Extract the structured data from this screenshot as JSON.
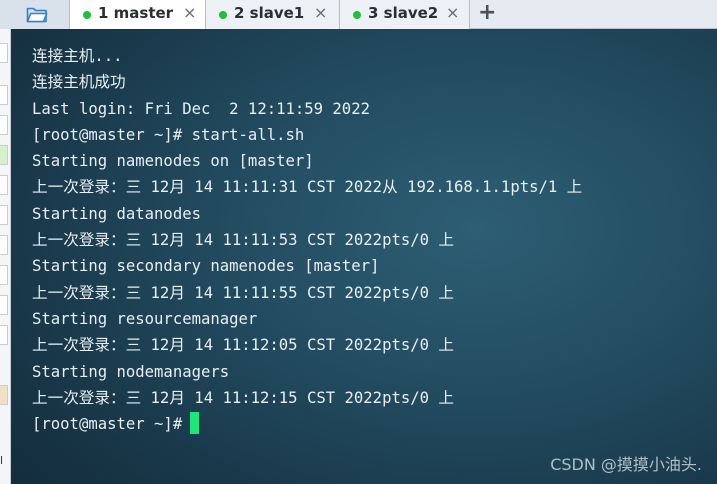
{
  "tabs": [
    {
      "label": "1 master",
      "status": "connected",
      "active": true
    },
    {
      "label": "2 slave1",
      "status": "connected",
      "active": false
    },
    {
      "label": "3 slave2",
      "status": "connected",
      "active": false
    }
  ],
  "tab_close_glyph": "×",
  "add_tab_glyph": "+",
  "colors": {
    "status_dot": "#1fbf3b",
    "cursor": "#1fe67a",
    "terminal_bg": "#1e4256",
    "terminal_text": "#e9eef2"
  },
  "terminal": {
    "lines": [
      "连接主机...",
      "连接主机成功",
      "Last login: Fri Dec  2 12:11:59 2022",
      "[root@master ~]# start-all.sh",
      "Starting namenodes on [master]",
      "上一次登录：三 12月 14 11:11:31 CST 2022从 192.168.1.1pts/1 上",
      "Starting datanodes",
      "上一次登录：三 12月 14 11:11:53 CST 2022pts/0 上",
      "Starting secondary namenodes [master]",
      "上一次登录：三 12月 14 11:11:55 CST 2022pts/0 上",
      "Starting resourcemanager",
      "上一次登录：三 12月 14 11:12:05 CST 2022pts/0 上",
      "Starting nodemanagers",
      "上一次登录：三 12月 14 11:12:15 CST 2022pts/0 上"
    ],
    "prompt": "[root@master ~]#"
  },
  "watermark": "CSDN @摸摸小油头.",
  "left_strip": {
    "chars": [
      "l"
    ]
  }
}
